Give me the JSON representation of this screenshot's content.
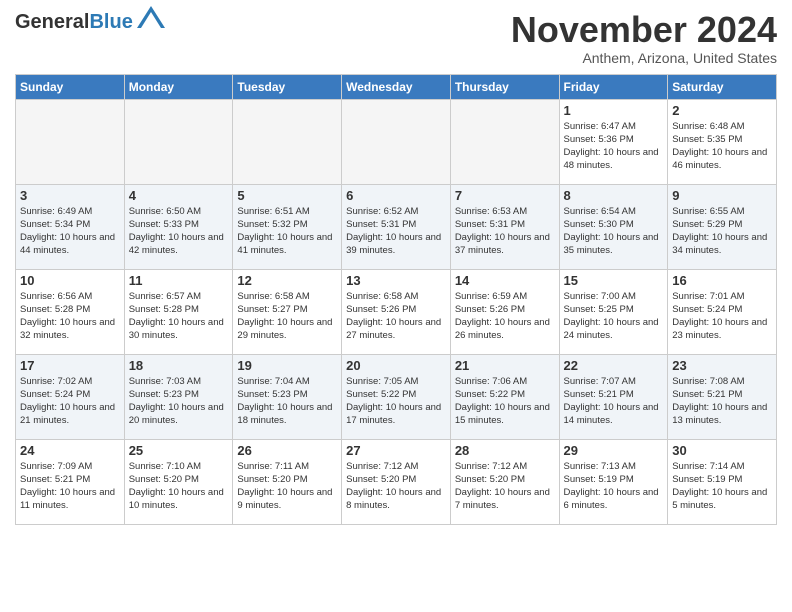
{
  "header": {
    "logo_line1": "General",
    "logo_line2": "Blue",
    "month_title": "November 2024",
    "subtitle": "Anthem, Arizona, United States"
  },
  "days_of_week": [
    "Sunday",
    "Monday",
    "Tuesday",
    "Wednesday",
    "Thursday",
    "Friday",
    "Saturday"
  ],
  "weeks": [
    [
      {
        "day": "",
        "empty": true
      },
      {
        "day": "",
        "empty": true
      },
      {
        "day": "",
        "empty": true
      },
      {
        "day": "",
        "empty": true
      },
      {
        "day": "",
        "empty": true
      },
      {
        "day": "1",
        "sunrise": "6:47 AM",
        "sunset": "5:36 PM",
        "daylight": "10 hours and 48 minutes."
      },
      {
        "day": "2",
        "sunrise": "6:48 AM",
        "sunset": "5:35 PM",
        "daylight": "10 hours and 46 minutes."
      }
    ],
    [
      {
        "day": "3",
        "sunrise": "6:49 AM",
        "sunset": "5:34 PM",
        "daylight": "10 hours and 44 minutes."
      },
      {
        "day": "4",
        "sunrise": "6:50 AM",
        "sunset": "5:33 PM",
        "daylight": "10 hours and 42 minutes."
      },
      {
        "day": "5",
        "sunrise": "6:51 AM",
        "sunset": "5:32 PM",
        "daylight": "10 hours and 41 minutes."
      },
      {
        "day": "6",
        "sunrise": "6:52 AM",
        "sunset": "5:31 PM",
        "daylight": "10 hours and 39 minutes."
      },
      {
        "day": "7",
        "sunrise": "6:53 AM",
        "sunset": "5:31 PM",
        "daylight": "10 hours and 37 minutes."
      },
      {
        "day": "8",
        "sunrise": "6:54 AM",
        "sunset": "5:30 PM",
        "daylight": "10 hours and 35 minutes."
      },
      {
        "day": "9",
        "sunrise": "6:55 AM",
        "sunset": "5:29 PM",
        "daylight": "10 hours and 34 minutes."
      }
    ],
    [
      {
        "day": "10",
        "sunrise": "6:56 AM",
        "sunset": "5:28 PM",
        "daylight": "10 hours and 32 minutes."
      },
      {
        "day": "11",
        "sunrise": "6:57 AM",
        "sunset": "5:28 PM",
        "daylight": "10 hours and 30 minutes."
      },
      {
        "day": "12",
        "sunrise": "6:58 AM",
        "sunset": "5:27 PM",
        "daylight": "10 hours and 29 minutes."
      },
      {
        "day": "13",
        "sunrise": "6:58 AM",
        "sunset": "5:26 PM",
        "daylight": "10 hours and 27 minutes."
      },
      {
        "day": "14",
        "sunrise": "6:59 AM",
        "sunset": "5:26 PM",
        "daylight": "10 hours and 26 minutes."
      },
      {
        "day": "15",
        "sunrise": "7:00 AM",
        "sunset": "5:25 PM",
        "daylight": "10 hours and 24 minutes."
      },
      {
        "day": "16",
        "sunrise": "7:01 AM",
        "sunset": "5:24 PM",
        "daylight": "10 hours and 23 minutes."
      }
    ],
    [
      {
        "day": "17",
        "sunrise": "7:02 AM",
        "sunset": "5:24 PM",
        "daylight": "10 hours and 21 minutes."
      },
      {
        "day": "18",
        "sunrise": "7:03 AM",
        "sunset": "5:23 PM",
        "daylight": "10 hours and 20 minutes."
      },
      {
        "day": "19",
        "sunrise": "7:04 AM",
        "sunset": "5:23 PM",
        "daylight": "10 hours and 18 minutes."
      },
      {
        "day": "20",
        "sunrise": "7:05 AM",
        "sunset": "5:22 PM",
        "daylight": "10 hours and 17 minutes."
      },
      {
        "day": "21",
        "sunrise": "7:06 AM",
        "sunset": "5:22 PM",
        "daylight": "10 hours and 15 minutes."
      },
      {
        "day": "22",
        "sunrise": "7:07 AM",
        "sunset": "5:21 PM",
        "daylight": "10 hours and 14 minutes."
      },
      {
        "day": "23",
        "sunrise": "7:08 AM",
        "sunset": "5:21 PM",
        "daylight": "10 hours and 13 minutes."
      }
    ],
    [
      {
        "day": "24",
        "sunrise": "7:09 AM",
        "sunset": "5:21 PM",
        "daylight": "10 hours and 11 minutes."
      },
      {
        "day": "25",
        "sunrise": "7:10 AM",
        "sunset": "5:20 PM",
        "daylight": "10 hours and 10 minutes."
      },
      {
        "day": "26",
        "sunrise": "7:11 AM",
        "sunset": "5:20 PM",
        "daylight": "10 hours and 9 minutes."
      },
      {
        "day": "27",
        "sunrise": "7:12 AM",
        "sunset": "5:20 PM",
        "daylight": "10 hours and 8 minutes."
      },
      {
        "day": "28",
        "sunrise": "7:12 AM",
        "sunset": "5:20 PM",
        "daylight": "10 hours and 7 minutes."
      },
      {
        "day": "29",
        "sunrise": "7:13 AM",
        "sunset": "5:19 PM",
        "daylight": "10 hours and 6 minutes."
      },
      {
        "day": "30",
        "sunrise": "7:14 AM",
        "sunset": "5:19 PM",
        "daylight": "10 hours and 5 minutes."
      }
    ]
  ]
}
